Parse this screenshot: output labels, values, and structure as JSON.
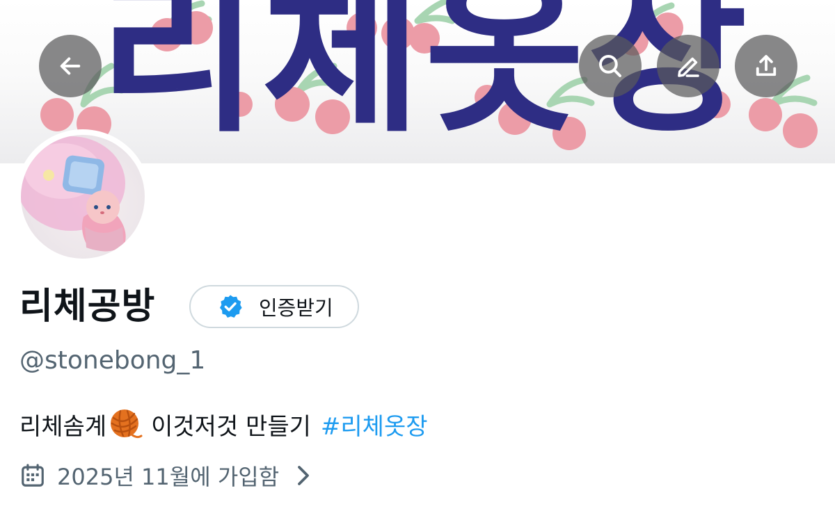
{
  "banner": {
    "text": "리체옷장",
    "colors": {
      "text": "#2e2d84",
      "cherry": "#ec9ca7",
      "stem": "#a8d5b2"
    }
  },
  "nav": {
    "back_icon": "arrow-left-icon",
    "search_icon": "search-icon",
    "edit_icon": "pencil-icon",
    "share_icon": "share-upload-icon"
  },
  "profile": {
    "display_name": "리체공방",
    "verify_label": "인증받기",
    "verify_icon": "verified-badge-icon",
    "handle": "@stonebong_1",
    "bio_text": "리체솜계",
    "bio_emoji": "yarn-ball-icon",
    "bio_text_2": "이것저것 만들기",
    "bio_hashtag": "#리체옷장",
    "joined_text": "2025년 11월에 가입함",
    "joined_icon": "calendar-icon"
  },
  "colors": {
    "primary_text": "#0f1419",
    "secondary_text": "#536471",
    "link": "#1d9bf0",
    "verified": "#1d9bf0"
  }
}
